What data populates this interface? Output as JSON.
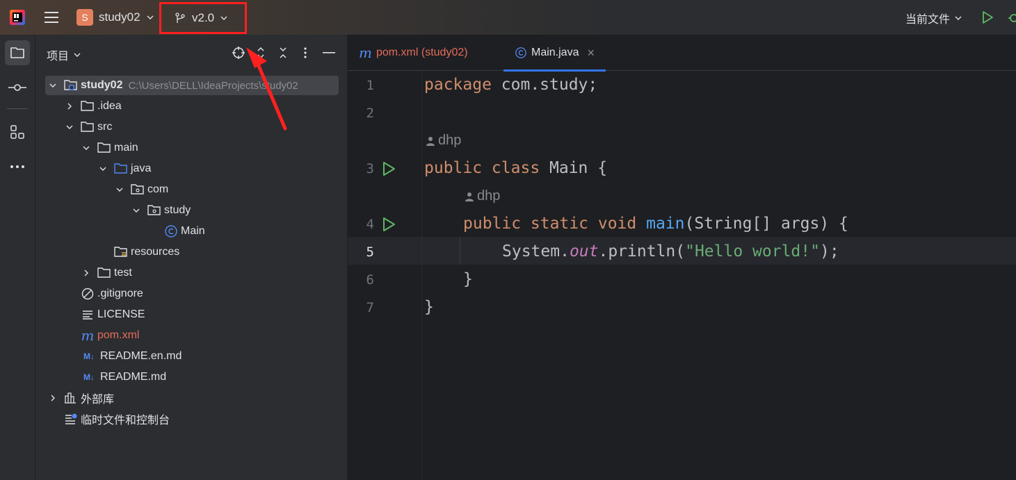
{
  "titlebar": {
    "project_badge": "S",
    "project_name": "study02",
    "branch": "v2.0",
    "run_config": "当前文件"
  },
  "leftstrip": {
    "icons": [
      "folder-icon",
      "commit-icon",
      "structure-icon",
      "more-icon"
    ]
  },
  "project_panel": {
    "title": "项目",
    "tree": [
      {
        "label": "study02",
        "path": "C:\\Users\\DELL\\IdeaProjects\\study02",
        "icon": "module-folder-icon"
      },
      {
        "label": ".idea",
        "icon": "folder-icon"
      },
      {
        "label": "src",
        "icon": "folder-icon"
      },
      {
        "label": "main",
        "icon": "folder-icon"
      },
      {
        "label": "java",
        "icon": "source-folder-icon"
      },
      {
        "label": "com",
        "icon": "package-icon"
      },
      {
        "label": "study",
        "icon": "package-icon"
      },
      {
        "label": "Main",
        "icon": "class-icon"
      },
      {
        "label": "resources",
        "icon": "resources-folder-icon"
      },
      {
        "label": "test",
        "icon": "folder-icon"
      },
      {
        "label": ".gitignore",
        "icon": "ignore-icon"
      },
      {
        "label": "LICENSE",
        "icon": "text-file-icon"
      },
      {
        "label": "pom.xml",
        "icon": "maven-icon"
      },
      {
        "label": "README.en.md",
        "icon": "markdown-icon"
      },
      {
        "label": "README.md",
        "icon": "markdown-icon"
      },
      {
        "label": "外部库",
        "icon": "library-icon"
      },
      {
        "label": "临时文件和控制台",
        "icon": "scratch-icon"
      }
    ]
  },
  "editor": {
    "tabs": [
      {
        "label": "pom.xml (study02)",
        "icon": "maven-icon"
      },
      {
        "label": "Main.java",
        "icon": "class-icon",
        "close": "×"
      }
    ],
    "author_hint": "dhp",
    "line_numbers": [
      "1",
      "2",
      "3",
      "4",
      "5",
      "6",
      "7"
    ],
    "code": {
      "l1_kw": "package",
      "l1_rest": " com.study;",
      "l3_kw": "public class",
      "l3_rest": " Main {",
      "l4_kw": "public static void",
      "l4_fn": "main",
      "l4_rest": "(String[] args) {",
      "l5_a": "System.",
      "l5_out": "out",
      "l5_b": ".println(",
      "l5_str": "\"Hello world!\"",
      "l5_c": ");",
      "l6": "}",
      "l7": "}"
    }
  },
  "colors": {
    "annotation_red": "#ff2020",
    "accent": "#3574f0"
  }
}
